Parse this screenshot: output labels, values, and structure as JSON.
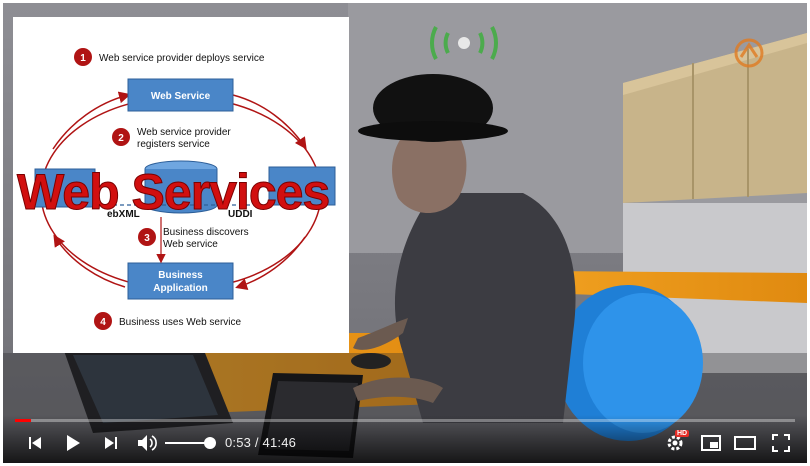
{
  "video": {
    "current_time": "0:53",
    "duration": "41:46",
    "separator": "/",
    "progress": 0.021,
    "volume": 0.9,
    "quality_badge": "HD"
  },
  "slide": {
    "steps": [
      {
        "num": "1",
        "text": "Web service provider deploys service"
      },
      {
        "num": "2",
        "text_line1": "Web service provider",
        "text_line2": "registers service"
      },
      {
        "num": "3",
        "text_line1": "Business discovers",
        "text_line2": "Web service"
      },
      {
        "num": "4",
        "text": "Business uses Web service"
      }
    ],
    "boxes": {
      "web_service": "Web Service",
      "business_app_line1": "Business",
      "business_app_line2": "Application"
    },
    "labels": {
      "left": "ebXML",
      "right": "UDDI"
    }
  },
  "overlay_title": "Web Services",
  "colors": {
    "accent": "#ff0000",
    "slide_red": "#b01414",
    "box_blue": "#4a86c8"
  },
  "icons": {
    "prev": "skip-previous-icon",
    "play": "play-icon",
    "next": "skip-next-icon",
    "volume": "volume-icon",
    "settings": "settings-gear-icon",
    "miniplayer": "miniplayer-icon",
    "theater": "theater-mode-icon",
    "fullscreen": "fullscreen-icon"
  }
}
